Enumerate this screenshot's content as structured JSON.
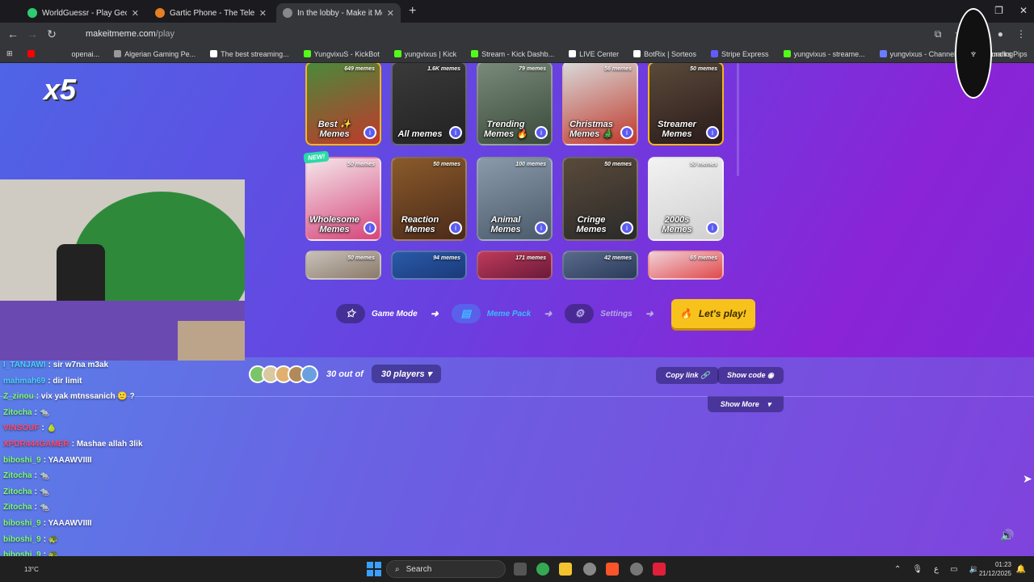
{
  "tabs": [
    {
      "title": "WorldGuessr - Play Geoguessr",
      "color": "#2ecc71"
    },
    {
      "title": "Gartic Phone - The Telephone G",
      "color": "#e67e22"
    },
    {
      "title": "In the lobby - Make it Meme",
      "color": "#888888",
      "active": true
    }
  ],
  "address": {
    "domain": "makeitmeme.com",
    "path": "/play"
  },
  "bookmarks": [
    {
      "label": "openai...",
      "color": "#10a37f"
    },
    {
      "label": "Algerian Gaming Pe...",
      "color": "#999999"
    },
    {
      "label": "The best streaming...",
      "color": "#ffffff"
    },
    {
      "label": "YungvixuS - KickBot",
      "color": "#53fc18"
    },
    {
      "label": "yungvixus | Kick",
      "color": "#53fc18"
    },
    {
      "label": "Stream - Kick Dashb...",
      "color": "#53fc18"
    },
    {
      "label": "LIVE Center",
      "color": "#ffffff"
    },
    {
      "label": "BotRix | Sorteos",
      "color": "#ffffff"
    },
    {
      "label": "Stripe Express",
      "color": "#635bff"
    },
    {
      "label": "yungvixus - streame...",
      "color": "#53fc18"
    },
    {
      "label": "yungvixus - Channel...",
      "color": "#6a7cff"
    },
    {
      "label": "FundingPips",
      "color": "#ffffff"
    }
  ],
  "bookmarks_all": "Bookmarks",
  "meme_cards": [
    {
      "count": "649 memes",
      "label": "Best ✨ Memes",
      "colors": [
        "#4a8a3a",
        "#c0392b"
      ]
    },
    {
      "count": "1.6K memes",
      "label": "All memes",
      "colors": [
        "#3a3a3a",
        "#222222"
      ]
    },
    {
      "count": "79 memes",
      "label": "Trending Memes 🔥",
      "colors": [
        "#7a8a7a",
        "#3a4a3a"
      ]
    },
    {
      "count": "56 memes",
      "label": "Christmas Memes 🎄",
      "colors": [
        "#d8d8d8",
        "#c0392b"
      ]
    },
    {
      "count": "50 memes",
      "label": "Streamer Memes",
      "colors": [
        "#5a4a3a",
        "#2a1a1a"
      ]
    },
    {
      "count": "50 memes",
      "label": "Wholesome Memes",
      "colors": [
        "#f4e6ea",
        "#d6457a"
      ]
    },
    {
      "count": "50 memes",
      "label": "Reaction Memes",
      "colors": [
        "#8a5a2a",
        "#4a2a1a"
      ]
    },
    {
      "count": "100 memes",
      "label": "Animal Memes",
      "colors": [
        "#8a9aaa",
        "#4a5a6a"
      ]
    },
    {
      "count": "50 memes",
      "label": "Cringe Memes",
      "colors": [
        "#5a4a3a",
        "#2a2a2a"
      ]
    },
    {
      "count": "50 memes",
      "label": "2000s Memes",
      "colors": [
        "#f2f2f2",
        "#d0d0d0"
      ]
    },
    {
      "count": "50 memes",
      "label": "",
      "colors": [
        "#c8c0b8",
        "#8a7a6a"
      ]
    },
    {
      "count": "94 memes",
      "label": "",
      "colors": [
        "#2a5aa8",
        "#1a3a7a"
      ]
    },
    {
      "count": "171 memes",
      "label": "",
      "colors": [
        "#c03a5a",
        "#6a1a3a"
      ]
    },
    {
      "count": "42 memes",
      "label": "",
      "colors": [
        "#5a6a8a",
        "#2a3a5a"
      ]
    },
    {
      "count": "65 memes",
      "label": "",
      "colors": [
        "#f0d0d8",
        "#e04a4a"
      ]
    }
  ],
  "new_badge": "NEW!",
  "steps": {
    "game_mode": "Game Mode",
    "meme_pack": "Meme Pack",
    "settings": "Settings",
    "play": "Let's play!"
  },
  "players": {
    "count_text": "30 out of",
    "select": "30 players"
  },
  "buttons": {
    "copy_link": "Copy link",
    "show_code": "Show code",
    "show_more": "Show More"
  },
  "overlay": {
    "multiplier": "x5"
  },
  "chat": [
    {
      "user": "I_TANJAWI",
      "text": "sir w7na m3ak",
      "color": "#4ad0ff"
    },
    {
      "user": "mahmah69",
      "text": "dir limit",
      "color": "#4ad0ff"
    },
    {
      "user": "Z_zinou",
      "text": "vix yak mtnssanich 🙂 ?",
      "color": "#7cff6a"
    },
    {
      "user": "Zitocha",
      "text": "🐀",
      "color": "#7cff6a"
    },
    {
      "user": "VINSOUF",
      "text": "🍐",
      "color": "#ff4a6a"
    },
    {
      "user": "XPDR444GAMER",
      "text": "Mashae allah 3lik",
      "color": "#ff4a6a"
    },
    {
      "user": "biboshi_9",
      "text": "YAAAWVIIII",
      "color": "#7cff6a"
    },
    {
      "user": "Zitocha",
      "text": "🐀",
      "color": "#7cff6a"
    },
    {
      "user": "Zitocha",
      "text": "🐀",
      "color": "#7cff6a"
    },
    {
      "user": "Zitocha",
      "text": "🐀",
      "color": "#7cff6a"
    },
    {
      "user": "biboshi_9",
      "text": "YAAAWVIIII",
      "color": "#7cff6a"
    },
    {
      "user": "biboshi_9",
      "text": "🐢",
      "color": "#7cff6a"
    },
    {
      "user": "biboshi_9",
      "text": "🐢",
      "color": "#7cff6a"
    }
  ],
  "taskbar": {
    "search": "Search",
    "weather": "13°C",
    "time": "01:23",
    "date": "21/12/2025"
  },
  "colors": {
    "accent": "#f8c21c",
    "page_start": "#4f64e6",
    "page_end": "#8a24d6"
  }
}
